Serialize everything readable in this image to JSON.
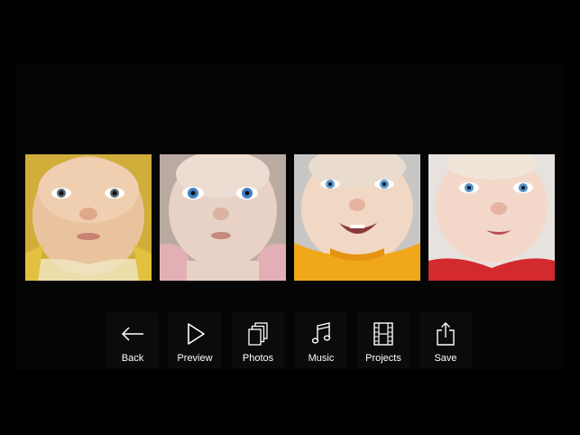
{
  "app": {
    "background_color": "#000000",
    "canvas_color": "#050505"
  },
  "photos": [
    {
      "name": "baby photo 1",
      "tint": "#e8c23a"
    },
    {
      "name": "baby photo 2",
      "tint": "#c9b8b0"
    },
    {
      "name": "baby photo 3",
      "tint": "#f0a020"
    },
    {
      "name": "baby photo 4",
      "tint": "#d23030"
    }
  ],
  "toolbar": {
    "back_label": "Back",
    "back_icon": "arrow-left-icon",
    "preview_label": "Preview",
    "preview_icon": "play-icon",
    "photos_label": "Photos",
    "photos_icon": "photos-stack-icon",
    "music_label": "Music",
    "music_icon": "music-note-icon",
    "projects_label": "Projects",
    "projects_icon": "film-strip-icon",
    "save_label": "Save",
    "save_icon": "share-icon"
  }
}
